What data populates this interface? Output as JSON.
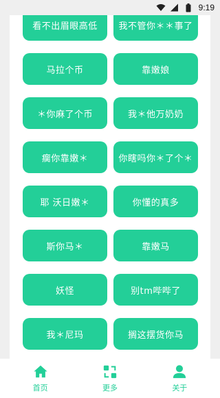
{
  "status_bar": {
    "time": "9:19",
    "icons": [
      "wifi-icon",
      "signal-icon",
      "battery-icon"
    ]
  },
  "accent_color": "#23cf98",
  "buttons": [
    "看不出眉眼高低",
    "我不管你＊＊事了",
    "马拉个币",
    "靠嫩娘",
    "＊你麻了个币",
    "我＊他万奶奶",
    "瘸你靠嫩＊",
    "你瞎吗你＊了个＊",
    "耶 沃日嫩＊",
    "你懂的真多",
    "斯你马＊",
    "靠嫩马",
    "妖怪",
    "别tm哔哔了",
    "我＊尼玛",
    "搁这摆货你马"
  ],
  "bottom_nav": [
    {
      "label": "首页",
      "icon": "home-icon"
    },
    {
      "label": "更多",
      "icon": "more-icon"
    },
    {
      "label": "关于",
      "icon": "user-icon"
    }
  ]
}
